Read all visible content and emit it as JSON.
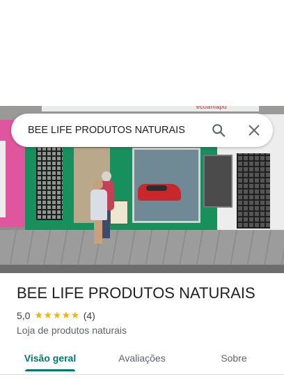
{
  "search": {
    "query": "BEE LIFE PRODUTOS NATURAIS"
  },
  "photo": {
    "sign_text": "ecoamapu"
  },
  "place": {
    "title": "BEE LIFE PRODUTOS NATURAIS",
    "rating_value": "5,0",
    "stars": "★★★★★",
    "rating_count": "(4)",
    "rating_stars": 5,
    "category": "Loja de produtos naturais"
  },
  "tabs": [
    {
      "label": "Visão geral",
      "active": true
    },
    {
      "label": "Avaliações",
      "active": false
    },
    {
      "label": "Sobre",
      "active": false
    }
  ],
  "colors": {
    "accent": "#00796b",
    "star": "#f4b400"
  },
  "icons": {
    "search": "search-icon",
    "close": "close-icon"
  }
}
